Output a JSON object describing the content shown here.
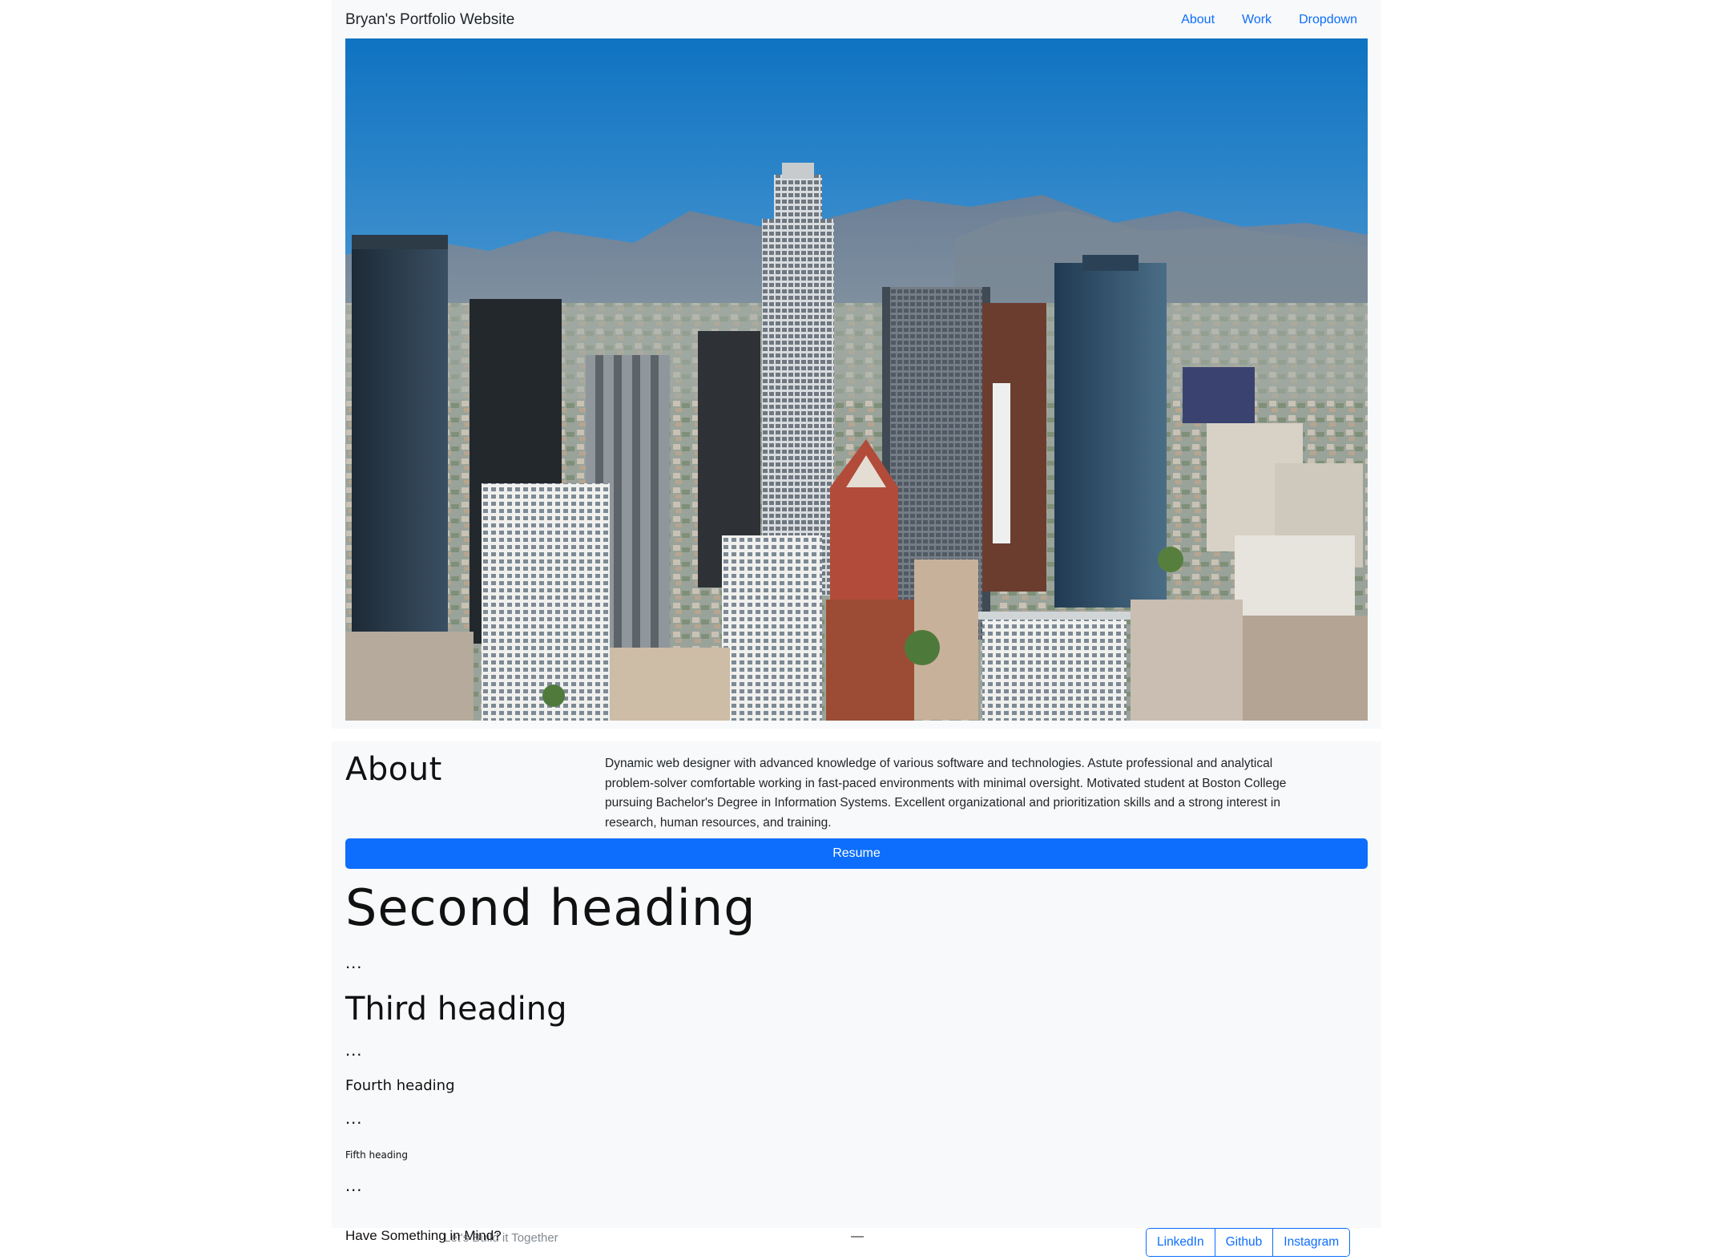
{
  "navbar": {
    "brand": "Bryan's Portfolio Website",
    "links": [
      "About",
      "Work",
      "Dropdown"
    ]
  },
  "hero": {
    "image": "city skyline with skyscrapers and mountains"
  },
  "about": {
    "title": "About",
    "text": "Dynamic web designer with advanced knowledge of various software and technologies. Astute professional and analytical problem-solver comfortable working in fast-paced environments with minimal oversight. Motivated student at Boston College pursuing Bachelor's Degree in Information Systems. Excellent organizational and prioritization skills and a strong interest in research, human resources, and training.",
    "button_label": "Resume"
  },
  "headings": {
    "second": "Second heading",
    "third": "Third heading",
    "fourth": "Fourth heading",
    "fifth": "Fifth heading",
    "ellipsis": "..."
  },
  "footer": {
    "title": "Have Something in Mind?",
    "subtitle": "Let's Build it Together",
    "dash": "—",
    "social": [
      "LinkedIn",
      "Github",
      "Instagram"
    ]
  },
  "colors": {
    "accent": "#0d6efd",
    "panel": "#f8f9fa"
  }
}
